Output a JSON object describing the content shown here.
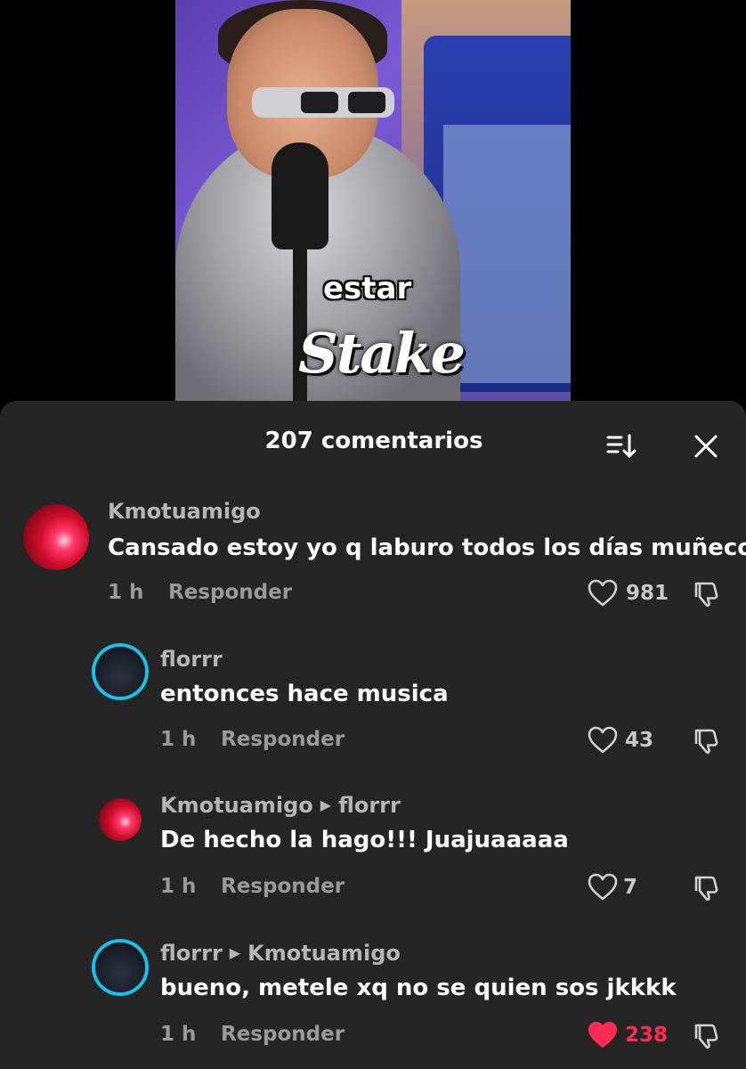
{
  "video": {
    "caption": "estar",
    "sponsor_logo_text": "Stake"
  },
  "sheet": {
    "title": "207 comentarios",
    "sort_icon": "sort-icon",
    "close_icon": "close-icon"
  },
  "colors": {
    "background": "#252525",
    "liked_heart": "#fe2c55",
    "avatar_ring": "#19c0e8"
  },
  "comments": [
    {
      "user": "Kmotuamigo",
      "reply_to": "",
      "text": "Cansado estoy yo q laburo todos los días muñeco",
      "time": "1 h",
      "reply_label": "Responder",
      "likes": "981",
      "liked": false
    },
    {
      "user": "florrr",
      "reply_to": "",
      "text": "entonces hace musica",
      "time": "1 h",
      "reply_label": "Responder",
      "likes": "43",
      "liked": false
    },
    {
      "user": "Kmotuamigo",
      "reply_to": "florrr",
      "text": "De hecho la hago!!! Juajuaaaaa",
      "time": "1 h",
      "reply_label": "Responder",
      "likes": "7",
      "liked": false
    },
    {
      "user": "florrr",
      "reply_to": "Kmotuamigo",
      "text": "bueno, metele xq no se quien sos jkkkk",
      "time": "1 h",
      "reply_label": "Responder",
      "likes": "238",
      "liked": true
    }
  ]
}
